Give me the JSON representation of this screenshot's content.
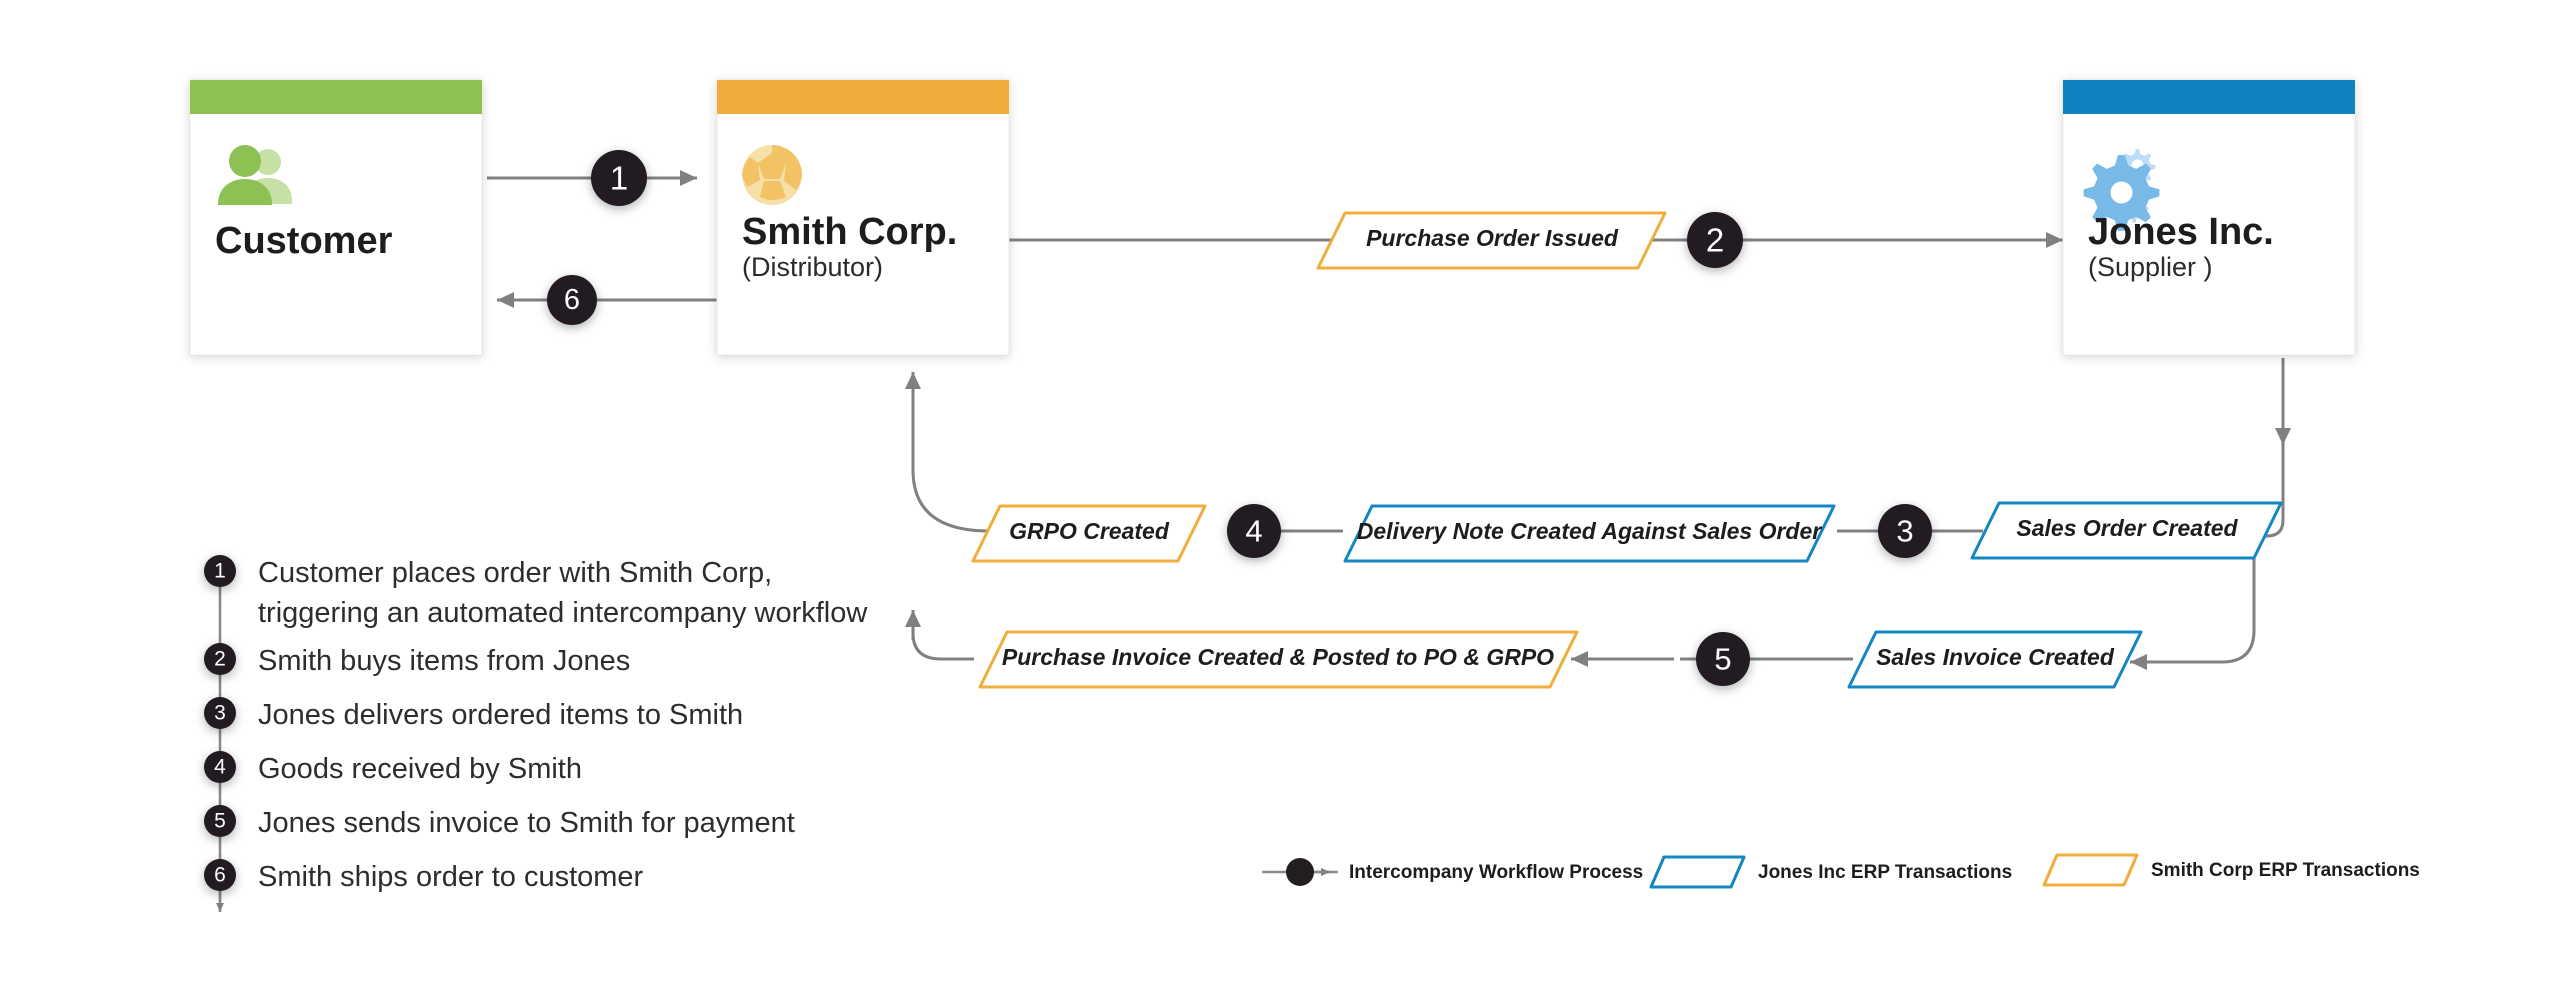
{
  "diagram": {
    "title": "Intercompany Workflow Process Diagram",
    "colors": {
      "customer_header": "#8dc153",
      "smith_header": "#f0ad3c",
      "jones_header": "#1082c0",
      "smith_shape_stroke": "#f0ad3c",
      "jones_shape_stroke": "#1387c4",
      "badge_fill": "#231f20",
      "connector": "#808080"
    },
    "entities": [
      {
        "id": "customer",
        "title": "Customer",
        "subtitle": "",
        "icon": "people-icon",
        "header_color": "#8dc153"
      },
      {
        "id": "smith",
        "title": "Smith Corp.",
        "subtitle": "(Distributor)",
        "icon": "ball-icon",
        "header_color": "#f0ad3c"
      },
      {
        "id": "jones",
        "title": "Jones Inc.",
        "subtitle": "(Supplier )",
        "icon": "gears-icon",
        "header_color": "#1082c0"
      }
    ],
    "flow_badges": [
      {
        "id": "badge-1",
        "number": "1"
      },
      {
        "id": "badge-2",
        "number": "2"
      },
      {
        "id": "badge-3",
        "number": "3"
      },
      {
        "id": "badge-4",
        "number": "4"
      },
      {
        "id": "badge-5",
        "number": "5"
      },
      {
        "id": "badge-6",
        "number": "6"
      }
    ],
    "transactions": [
      {
        "id": "purchase-order-issued",
        "label": "Purchase Order Issued",
        "owner": "smith"
      },
      {
        "id": "sales-order-created",
        "label": "Sales Order Created",
        "owner": "jones"
      },
      {
        "id": "delivery-note-created",
        "label": "Delivery Note Created Against Sales Order",
        "owner": "jones"
      },
      {
        "id": "grpo-created",
        "label": "GRPO Created",
        "owner": "smith"
      },
      {
        "id": "sales-invoice-created",
        "label": "Sales Invoice Created",
        "owner": "jones"
      },
      {
        "id": "purchase-invoice-created",
        "label": "Purchase Invoice Created & Posted to PO & GRPO",
        "owner": "smith"
      }
    ],
    "steps": [
      {
        "number": "1",
        "line1": "Customer places order with Smith Corp,",
        "line2": "triggering an automated intercompany workflow"
      },
      {
        "number": "2",
        "line1": "Smith buys items from Jones",
        "line2": ""
      },
      {
        "number": "3",
        "line1": "Jones delivers ordered items to Smith",
        "line2": ""
      },
      {
        "number": "4",
        "line1": "Goods received by Smith",
        "line2": ""
      },
      {
        "number": "5",
        "line1": "Jones sends invoice to Smith for payment",
        "line2": ""
      },
      {
        "number": "6",
        "line1": "Smith ships order to customer",
        "line2": ""
      }
    ],
    "legend": [
      {
        "id": "legend-workflow",
        "label": "Intercompany Workflow Process",
        "swatch": "arrow"
      },
      {
        "id": "legend-jones",
        "label": "Jones Inc ERP Transactions",
        "swatch": "parallelogram-blue"
      },
      {
        "id": "legend-smith",
        "label": "Smith Corp ERP Transactions",
        "swatch": "parallelogram-orange"
      }
    ]
  }
}
